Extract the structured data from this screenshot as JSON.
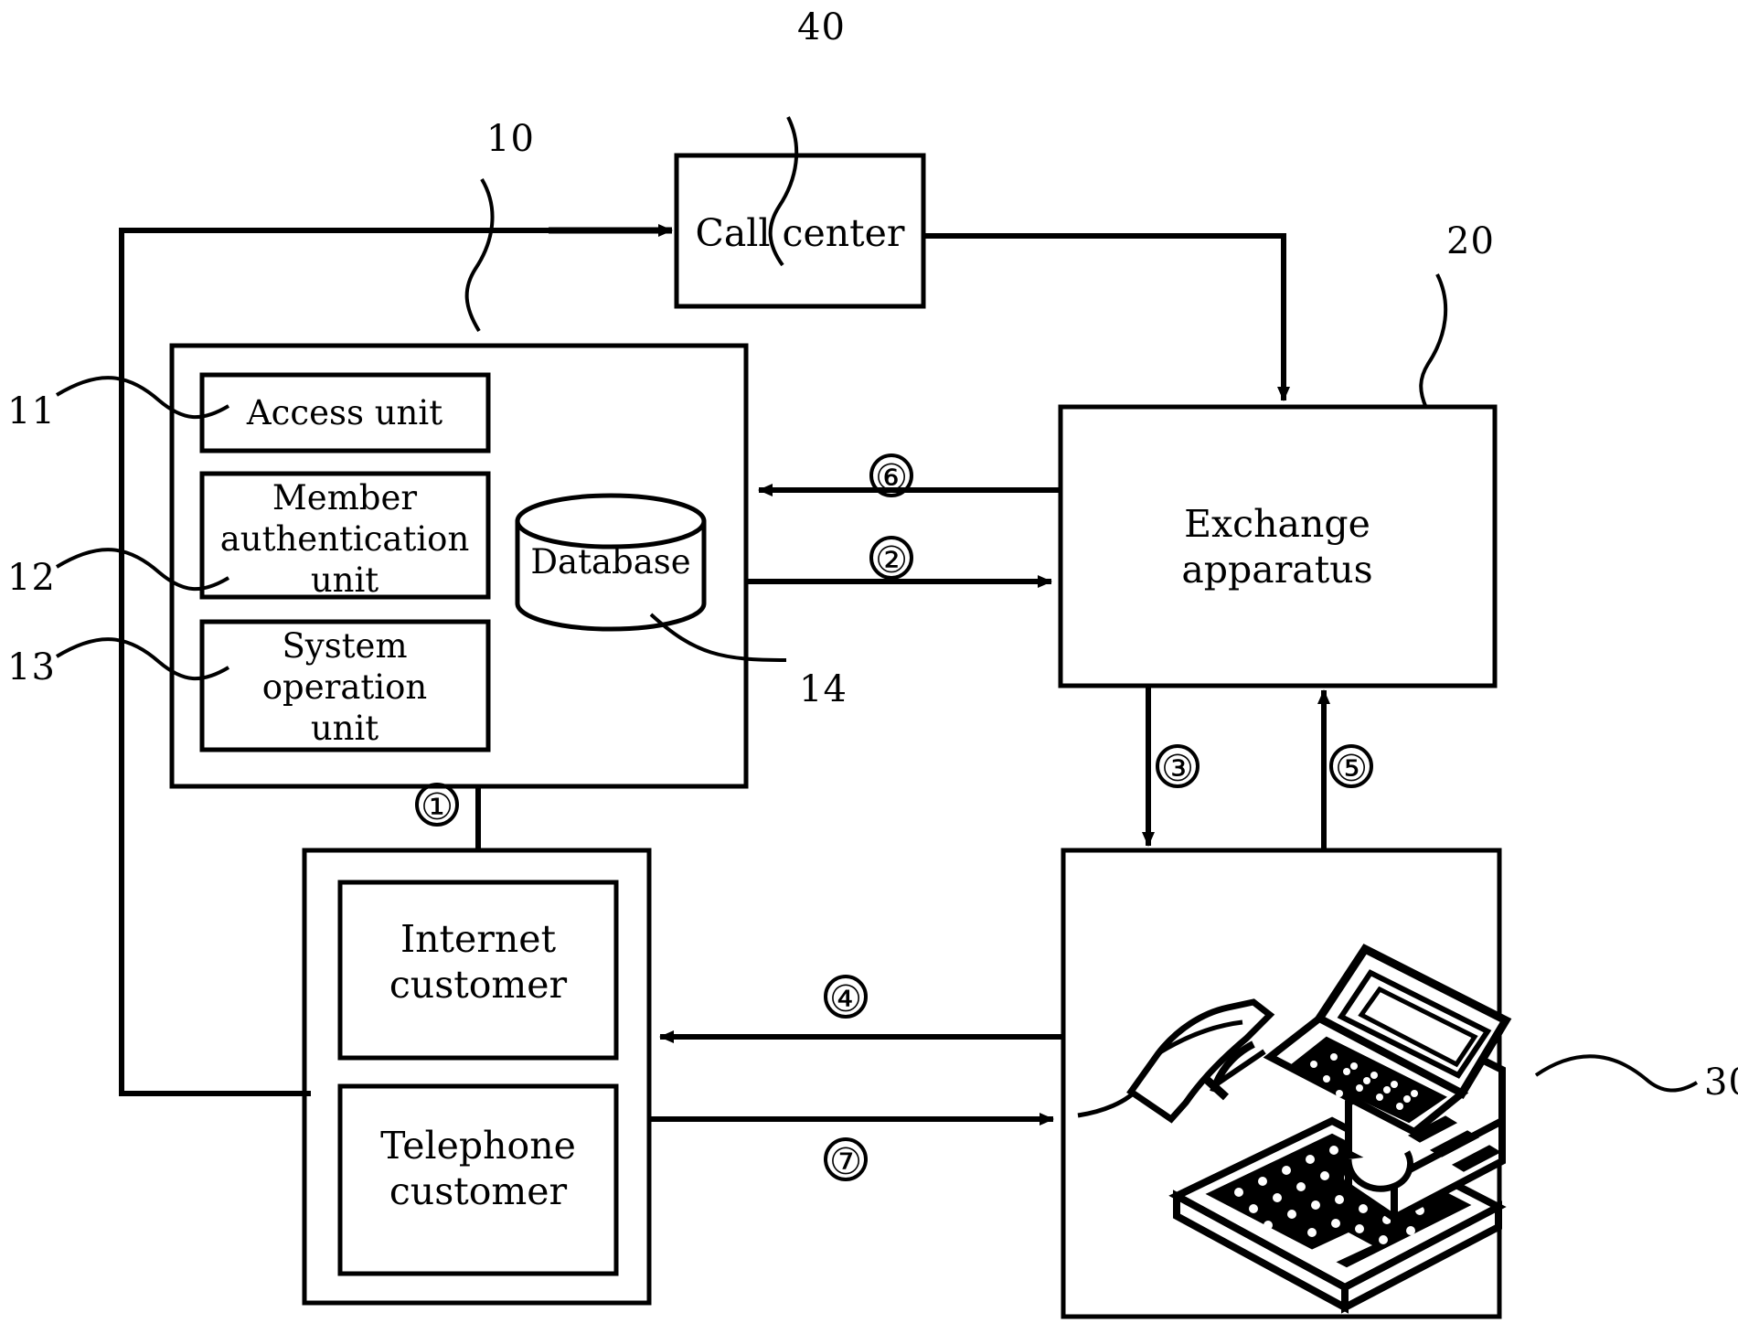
{
  "figure": {
    "type": "patent-block-diagram",
    "background_color": "#ffffff",
    "line_color": "#000000"
  },
  "blocks": {
    "call_center": {
      "label": "Call center",
      "ref": "40"
    },
    "system": {
      "ref": "10",
      "units": [
        {
          "label": "Access unit",
          "ref": "11"
        },
        {
          "label": "Member\nauthentication\nunit",
          "ref": "12"
        },
        {
          "label": "System\noperation\nunit",
          "ref": "13"
        }
      ],
      "database": {
        "label": "Database",
        "ref": "14"
      }
    },
    "exchange": {
      "label": "Exchange\napparatus",
      "ref": "20"
    },
    "customer": {
      "internet": {
        "label": "Internet\ncustomer"
      },
      "telephone": {
        "label": "Telephone\ncustomer"
      }
    },
    "workstation": {
      "ref": "30",
      "icon": "telephone-computer-keyboard-illustration"
    }
  },
  "flow_markers": [
    {
      "id": "m1",
      "symbol": "①",
      "from": "system",
      "to": "customer"
    },
    {
      "id": "m2",
      "symbol": "②",
      "from": "system",
      "to": "exchange"
    },
    {
      "id": "m3",
      "symbol": "③",
      "from": "exchange",
      "to": "workstation"
    },
    {
      "id": "m4",
      "symbol": "④",
      "from": "workstation",
      "to": "internet-customer"
    },
    {
      "id": "m5",
      "symbol": "⑤",
      "from": "workstation",
      "to": "exchange"
    },
    {
      "id": "m6",
      "symbol": "⑥",
      "from": "exchange",
      "to": "system"
    },
    {
      "id": "m7",
      "symbol": "⑦",
      "from": "telephone-customer",
      "to": "workstation"
    }
  ],
  "reference_numerals": {
    "n10": "10",
    "n11": "11",
    "n12": "12",
    "n13": "13",
    "n14": "14",
    "n20": "20",
    "n30": "30",
    "n40": "40"
  }
}
